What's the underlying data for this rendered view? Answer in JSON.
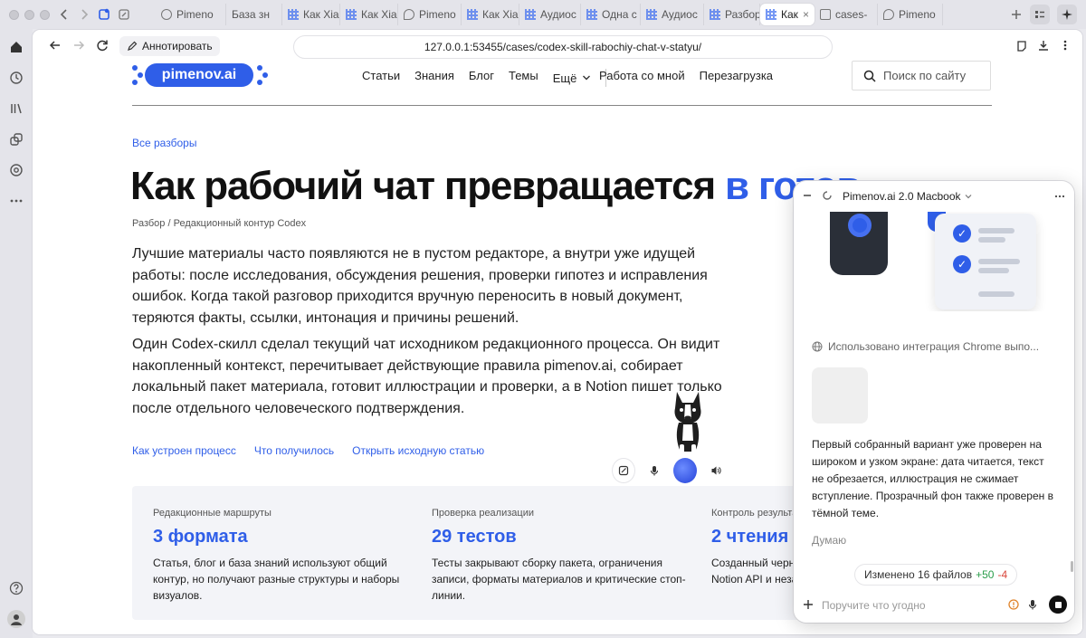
{
  "tabs": [
    {
      "label": "Pimeno",
      "icon": "circle-icon"
    },
    {
      "label": "База зн",
      "icon": "none"
    },
    {
      "label": "Как Xia",
      "icon": "grid-icon"
    },
    {
      "label": "Как Xia",
      "icon": "grid-icon"
    },
    {
      "label": "Pimeno",
      "icon": "sticker-icon"
    },
    {
      "label": "Как Xia",
      "icon": "grid-icon"
    },
    {
      "label": "Аудиос",
      "icon": "grid-icon"
    },
    {
      "label": "Одна с",
      "icon": "grid-icon"
    },
    {
      "label": "Аудиос",
      "icon": "grid-icon"
    },
    {
      "label": "Разбор",
      "icon": "grid-icon"
    },
    {
      "label": "Как",
      "icon": "grid-icon",
      "active": true
    },
    {
      "label": "cases-",
      "icon": "doc-icon"
    },
    {
      "label": "Pimeno",
      "icon": "sticker-icon"
    }
  ],
  "toolbar": {
    "annotate_label": "Аннотировать",
    "url": "127.0.0.1:53455/cases/codex-skill-rabochiy-chat-v-statyu/"
  },
  "site": {
    "logo": "pimenov.ai",
    "nav": [
      "Статьи",
      "Знания",
      "Блог",
      "Темы",
      "Ещё"
    ],
    "nav2": [
      "Работа со мной",
      "Перезагрузка"
    ],
    "search_placeholder": "Поиск по сайту",
    "back_link": "Все разборы",
    "title_main": "Как рабочий чат превращается ",
    "title_accent": "в готов",
    "meta": "Разбор / Редакционный контур Codex",
    "p1": "Лучшие материалы часто появляются не в пустом редакторе, а внутри уже идущей работы: после исследования, обсуждения решения, проверки гипотез и исправления ошибок. Когда такой разговор приходится вручную переносить в новый документ, теряются факты, ссылки, интонация и причины решений.",
    "p2": "Один Codex-скилл сделал текущий чат исходником редакционного процесса. Он видит накопленный контекст, перечитывает действующие правила pimenov.ai, собирает локальный пакет материала, готовит иллюстрации и проверки, а в Notion пишет только после отдельного человеческого подтверждения.",
    "links": [
      "Как устроен процесс",
      "Что получилось",
      "Открыть исходную статью"
    ],
    "stats": [
      {
        "label": "Редакционные маршруты",
        "value": "3 формата",
        "desc": "Статья, блог и база знаний используют общий контур, но получают разные структуры и наборы визуалов."
      },
      {
        "label": "Проверка реализации",
        "value": "29 тестов",
        "desc": "Тесты закрывают сборку пакета, ограничения записи, форматы материалов и критические стоп-линии."
      },
      {
        "label": "Контроль результа",
        "value": "2 чтения",
        "desc": "Созданный черн Notion API и неза"
      }
    ]
  },
  "panel": {
    "title": "Pimenov.ai 2.0 Macbook",
    "chrome_line": "Использовано интеграция Chrome выпо...",
    "message": "Первый собранный вариант уже проверен на широком и узком экране: дата читается, текст не обрезается, иллюстрация не сжимает вступление. Прозрачный фон также проверен в тёмной теме.",
    "thinking": "Думаю",
    "changed_label": "Изменено 16 файлов",
    "changed_plus": "+50",
    "changed_minus": "-4",
    "input_placeholder": "Поручите что угодно"
  },
  "colors": {
    "accent": "#2f5ee8",
    "added": "#2a9d4a",
    "removed": "#d9463b"
  }
}
